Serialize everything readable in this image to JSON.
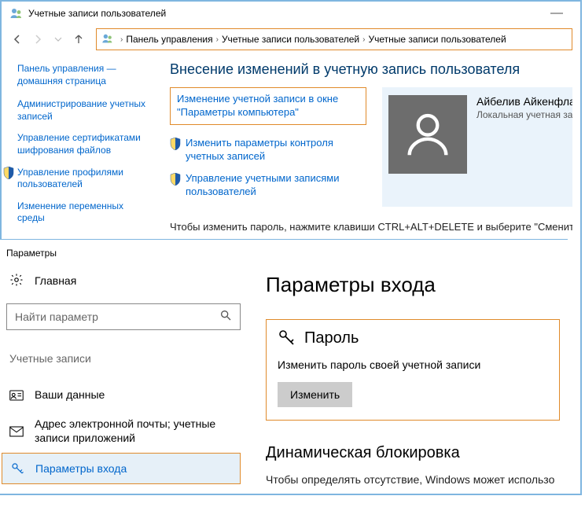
{
  "cp": {
    "title": "Учетные записи пользователей",
    "breadcrumb": {
      "crumb1": "Панель управления",
      "crumb2": "Учетные записи пользователей",
      "crumb3": "Учетные записи пользователей"
    },
    "home_link": "Панель управления — домашняя страница",
    "side_links": [
      "Администрирование учетных записей",
      "Управление сертификатами шифрования файлов",
      "Управление профилями пользователей",
      "Изменение переменных среды"
    ],
    "side_shield": [
      false,
      false,
      true,
      false
    ],
    "heading": "Внесение изменений в учетную запись пользователя",
    "highlight_link": "Изменение учетной записи в окне \"Параметры компьютера\"",
    "action_links": [
      "Изменить параметры контроля учетных записей",
      "Управление учетными записями пользователей"
    ],
    "user": {
      "name": "Айбелив Айкенфлае",
      "type": "Локальная учетная запись"
    },
    "notice": "Чтобы изменить пароль, нажмите клавиши CTRL+ALT+DELETE и выберите \"Сменить пароль"
  },
  "settings": {
    "title": "Параметры",
    "home": "Главная",
    "search_placeholder": "Найти параметр",
    "section": "Учетные записи",
    "nav": [
      "Ваши данные",
      "Адрес электронной почты; учетные записи приложений",
      "Параметры входа"
    ],
    "main_heading": "Параметры входа",
    "password": {
      "title": "Пароль",
      "desc": "Изменить пароль своей учетной записи",
      "button": "Изменить"
    },
    "dynamic": {
      "title": "Динамическая блокировка",
      "desc": "Чтобы определять отсутствие, Windows может использо"
    }
  }
}
